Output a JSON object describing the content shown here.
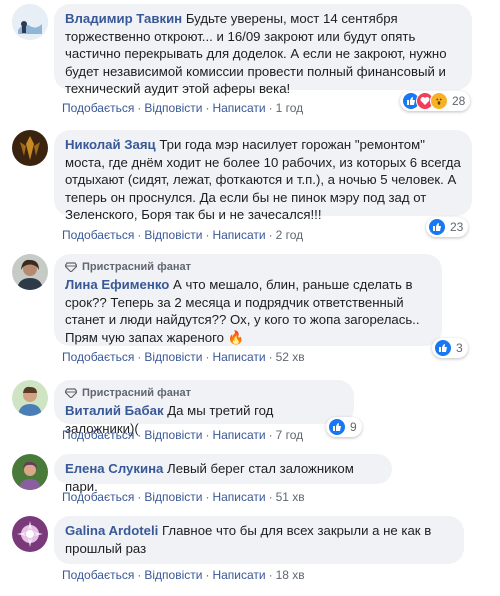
{
  "actions": {
    "like": "Подобається",
    "reply": "Відповісти",
    "write": "Написати"
  },
  "colors": {
    "author": "#385898",
    "bubble": "#f0f2f5",
    "like_blue": "#1877f2",
    "love_red": "#f33e58",
    "wow_yellow": "#f7b125"
  },
  "comments": [
    {
      "author": "Владимир Тавкин",
      "text": "Будьте уверены, мост 14 сентября торжественно откроют... и 16/09 закроют или будут опять частично перекрывать для доделок. А если не закроют, нужно будет независимой комиссии провести полный финансовый и технический аудит этой аферы века!",
      "time": "1 год",
      "reactions": "28",
      "reaction_icons": [
        "like-icon",
        "love-icon",
        "wow-icon"
      ]
    },
    {
      "author": "Николай Заяц",
      "text": "Три года мэр насилует горожан \"ремонтом\" моста, где днём ходит не более 10 рабочих, из которых 6 всегда отдыхают (сидят, лежат, фоткаются и т.п.), а ночью 5 человек. А теперь он проснулся. Да если бы не пинок мэру под зад от Зеленского, Боря так бы и не зачесался!!!",
      "time": "2 год",
      "reactions": "23",
      "reaction_icons": [
        "like-icon"
      ]
    },
    {
      "badge": "Пристрасний фанат",
      "author": "Лина Ефименко",
      "text": "А что мешало, блин, раньше сделать в срок?? Теперь за 2 месяца и подрядчик ответственный станет и люди найдутся?? Ох, у кого то жопа загорелась.. Прям чую запах жареного 🔥",
      "time": "52 хв",
      "reactions": "3",
      "reaction_icons": [
        "like-icon"
      ]
    },
    {
      "badge": "Пристрасний фанат",
      "author": "Виталий Бабак",
      "text": "Да мы третий год заложники)(",
      "time": "7 год",
      "reactions": "9",
      "reaction_icons": [
        "like-icon"
      ]
    },
    {
      "author": "Елена Слукина",
      "text": "Левый берег стал заложником пари.",
      "time": "51 хв"
    },
    {
      "author": "Galina Ardoteli",
      "text": "Главное что бы для всех закрыли а не как в прошлый раз",
      "time": "18 хв"
    }
  ]
}
